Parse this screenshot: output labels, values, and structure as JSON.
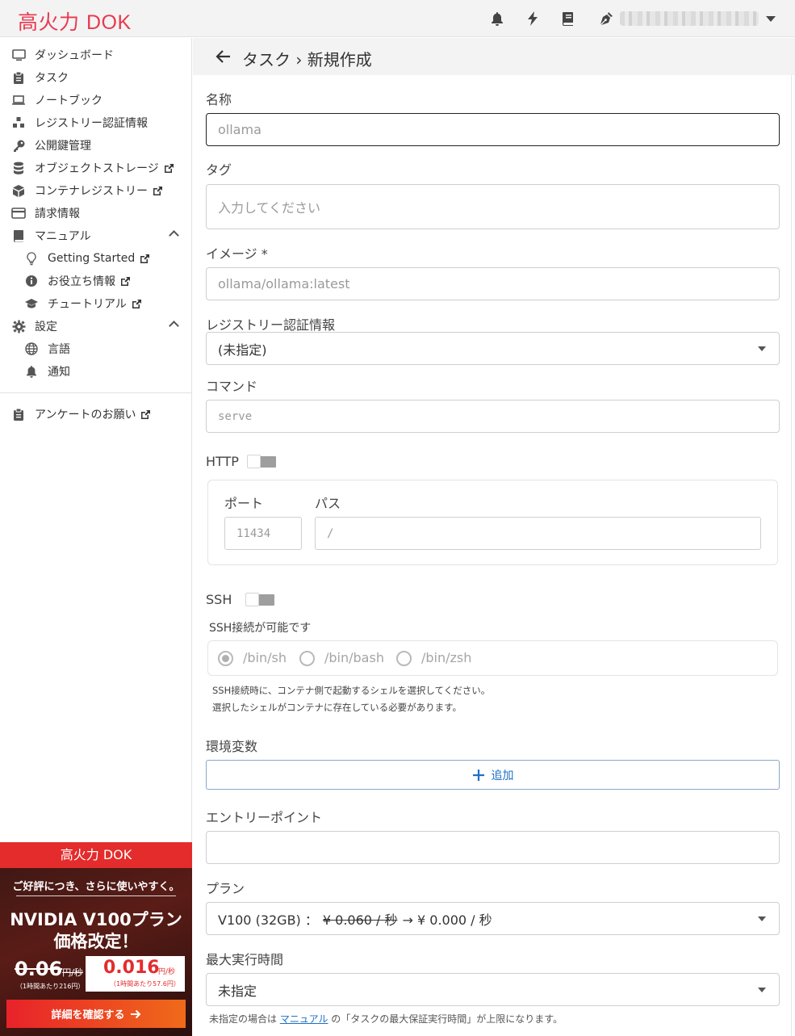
{
  "app": {
    "logo_kanji": "高火力",
    "logo_latin": "DOK"
  },
  "topbar": {
    "icons": [
      "bell-icon",
      "bolt-icon",
      "book-icon",
      "pen-nib-icon"
    ],
    "user_menu": "caret-down-icon"
  },
  "sidebar": {
    "items": [
      {
        "label": "ダッシュボード",
        "icon": "monitor-icon"
      },
      {
        "label": "タスク",
        "icon": "clipboard-icon"
      },
      {
        "label": "ノートブック",
        "icon": "laptop-icon"
      },
      {
        "label": "レジストリー認証情報",
        "icon": "cubes-icon"
      },
      {
        "label": "公開鍵管理",
        "icon": "key-icon"
      },
      {
        "label": "オブジェクトストレージ",
        "icon": "database-icon"
      },
      {
        "label": "コンテナレジストリー",
        "icon": "box-icon"
      },
      {
        "label": "請求情報",
        "icon": "credit-card-icon"
      },
      {
        "label": "マニュアル",
        "icon": "book-icon"
      },
      {
        "label": "Getting Started",
        "icon": "lightbulb-icon"
      },
      {
        "label": "お役立ち情報",
        "icon": "info-icon"
      },
      {
        "label": "チュートリアル",
        "icon": "graduation-cap-icon"
      },
      {
        "label": "設定",
        "icon": "gear-icon"
      },
      {
        "label": "言語",
        "icon": "globe-icon"
      },
      {
        "label": "通知",
        "icon": "bell-icon"
      },
      {
        "label": "アンケートのお願い",
        "icon": "clipboard-icon"
      }
    ]
  },
  "promo": {
    "header": "高火力 DOK",
    "tagline": "ご好評につき、さらに使いやすく。",
    "title_line1": "NVIDIA V100プラン",
    "title_line2": "価格改定！",
    "old_price": "0.06",
    "old_unit": "円/秒",
    "old_note": "（1時間あたり216円）",
    "new_price": "0.016",
    "new_unit": "円/秒",
    "new_note": "（1時間あたり57.6円）",
    "button": "詳細を確認する"
  },
  "page": {
    "breadcrumb": "タスク › 新規作成"
  },
  "form": {
    "name_label": "名称",
    "name_placeholder": "ollama",
    "tag_label": "タグ",
    "tag_placeholder": "入力してください",
    "image_label": "イメージ *",
    "image_placeholder": "ollama/ollama:latest",
    "registry_label": "レジストリー認証情報",
    "registry_value": "(未指定)",
    "command_label": "コマンド",
    "command_placeholder": "serve",
    "http_label": "HTTP",
    "port_label": "ポート",
    "port_placeholder": "11434",
    "path_label": "パス",
    "path_placeholder": "/",
    "ssh_label": "SSH",
    "ssh_sub_label": "SSH接続が可能です",
    "shells": [
      "/bin/sh",
      "/bin/bash",
      "/bin/zsh"
    ],
    "ssh_help1": "SSH接続時に、コンテナ側で起動するシェルを選択してください。",
    "ssh_help2": "選択したシェルがコンテナに存在している必要があります。",
    "env_label": "環境変数",
    "add_label": "追加",
    "entry_label": "エントリーポイント",
    "plan_label": "プラン",
    "plan_name": "V100 (32GB) ：",
    "plan_old": "¥ 0.060 / 秒",
    "plan_new": " → ¥ 0.000 / 秒",
    "maxtime_label": "最大実行時間",
    "maxtime_value": "未指定",
    "maxtime_note_pre": "未指定の場合は ",
    "maxtime_note_link": "マニュアル",
    "maxtime_note_post": " の「タスクの最大保証実行時間」が上限になります。"
  }
}
